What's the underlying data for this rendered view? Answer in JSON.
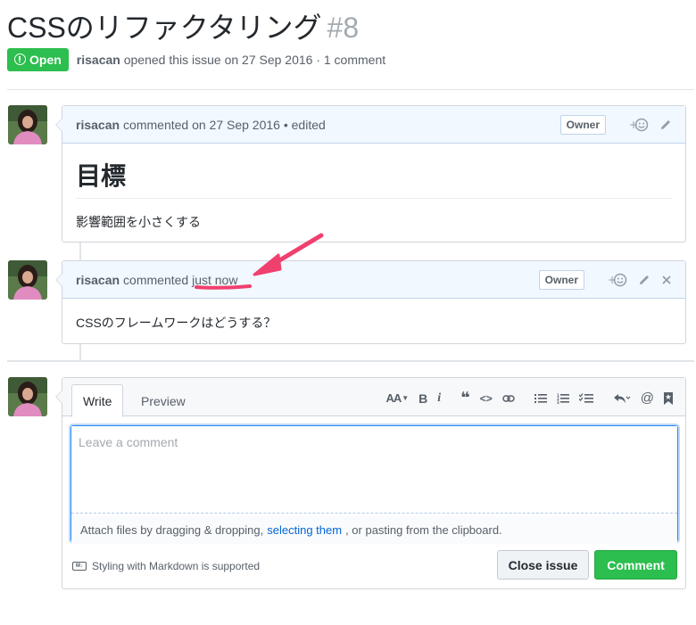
{
  "issue": {
    "title": "CSSのリファクタリング",
    "number": "#8",
    "state": "Open",
    "author": "risacan",
    "opened_text": "opened this issue on 27 Sep 2016 · 1 comment"
  },
  "comments": [
    {
      "author": "risacan",
      "action": "commented on 27 Sep 2016 • edited",
      "badge": "Owner",
      "heading": "目標",
      "body": "影響範囲を小さくする"
    },
    {
      "author": "risacan",
      "action_prefix": "commented",
      "timestamp": "just now",
      "badge": "Owner",
      "body": "CSSのフレームワークはどうする？"
    }
  ],
  "form": {
    "tabs": [
      "Write",
      "Preview"
    ],
    "placeholder": "Leave a comment",
    "attach_prefix": "Attach files by dragging & dropping,",
    "attach_link": "selecting them",
    "attach_suffix": ", or pasting from the clipboard.",
    "markdown_hint": "Styling with Markdown is supported",
    "markdown_icon_text": "M↓",
    "close_label": "Close issue",
    "comment_label": "Comment",
    "toolbar": {
      "header": "AA",
      "bold": "B",
      "italic": "i",
      "quote": "❝",
      "code": "<>",
      "mention": "@"
    }
  },
  "colors": {
    "open_green": "#2cbe4e",
    "link_blue": "#0366d6",
    "arrow_pink": "#f0406e"
  }
}
